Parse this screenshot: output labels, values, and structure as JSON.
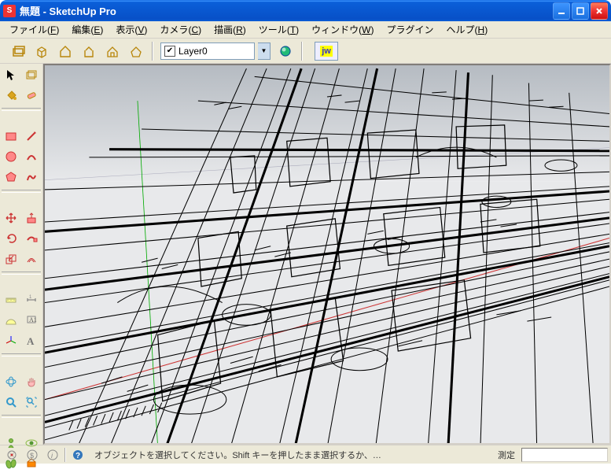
{
  "window": {
    "title": "無題 - SketchUp Pro"
  },
  "menu": {
    "file": {
      "label": "ファイル",
      "accel": "F"
    },
    "edit": {
      "label": "編集",
      "accel": "E"
    },
    "view": {
      "label": "表示",
      "accel": "V"
    },
    "camera": {
      "label": "カメラ",
      "accel": "C"
    },
    "draw": {
      "label": "描画",
      "accel": "R"
    },
    "tools": {
      "label": "ツール",
      "accel": "T"
    },
    "window": {
      "label": "ウィンドウ",
      "accel": "W"
    },
    "plugin": {
      "label": "プラグイン",
      "accel": ""
    },
    "help": {
      "label": "ヘルプ",
      "accel": "H"
    }
  },
  "toolbar_h": {
    "layer_current": "Layer0",
    "jw_label": "jw"
  },
  "statusbar": {
    "message": "オブジェクトを選択してください。Shift キーを押したまま選択するか、…",
    "measure_label": "測定",
    "measure_value": ""
  }
}
